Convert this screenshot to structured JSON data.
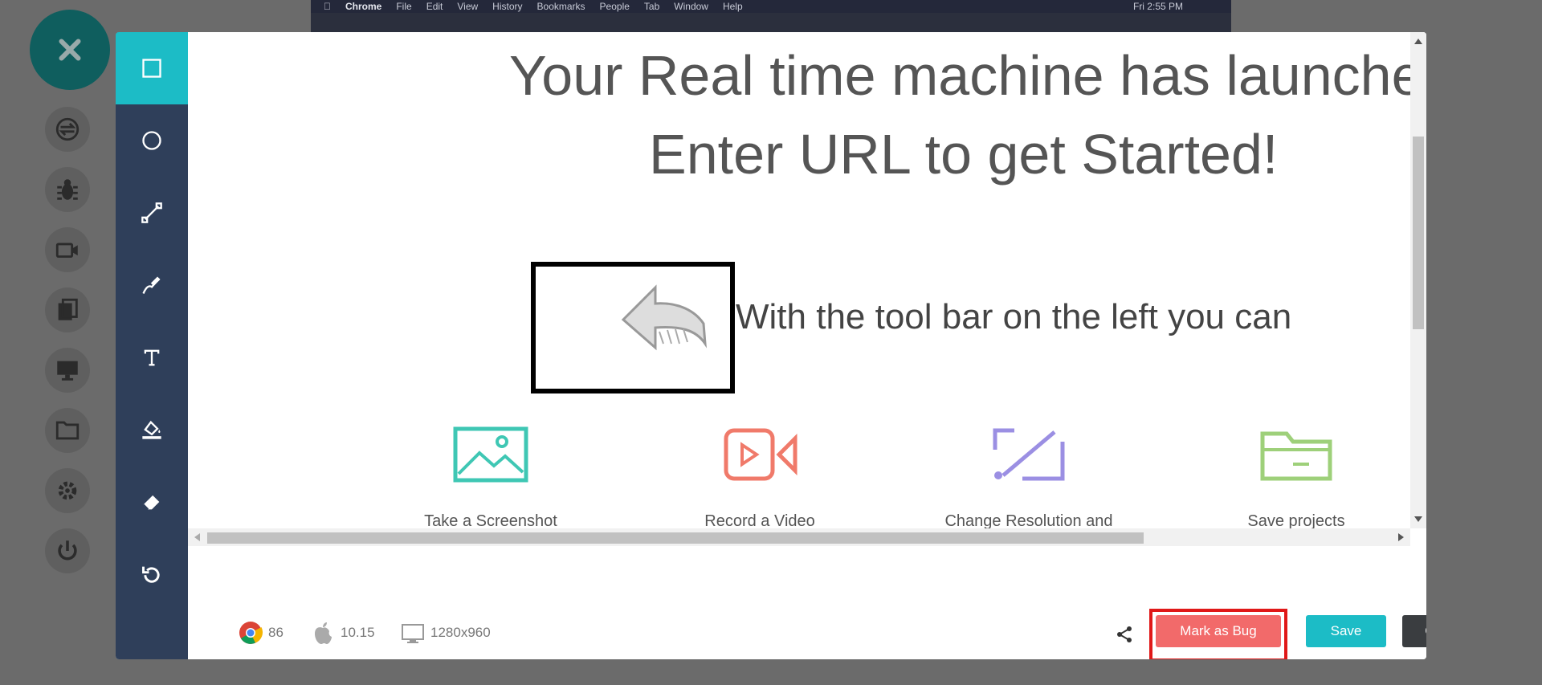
{
  "background_screen": {
    "app": "Chrome",
    "menus": [
      "File",
      "Edit",
      "View",
      "History",
      "Bookmarks",
      "People",
      "Tab",
      "Window",
      "Help"
    ],
    "clock": "Fri 2:55 PM"
  },
  "side_toolbar": {
    "close_icon": "close-icon",
    "items": [
      "switch-icon",
      "bug-icon",
      "video-icon",
      "copy-icon",
      "monitor-icon",
      "folder-icon",
      "gear-icon",
      "power-icon"
    ]
  },
  "tool_rail": {
    "tools": [
      "rectangle-icon",
      "circle-icon",
      "line-icon",
      "pen-icon",
      "text-icon",
      "fill-icon",
      "eraser-icon",
      "undo-icon"
    ],
    "active": "rectangle-icon"
  },
  "canvas": {
    "headline": "Your Real time machine has launched",
    "subheadline": "Enter URL to get Started!",
    "toolbar_text": "With the tool bar on the left you can",
    "features": [
      {
        "label": "Take a Screenshot",
        "icon": "image-icon",
        "color": "#3fc7b4"
      },
      {
        "label": "Record a Video",
        "icon": "video-icon",
        "color": "#f07a6a"
      },
      {
        "label": "Change Resolution and",
        "icon": "resolution-icon",
        "color": "#9b8fe3"
      },
      {
        "label": "Save projects",
        "icon": "folder-icon",
        "color": "#9ed07a"
      }
    ]
  },
  "footer": {
    "browser_version": "86",
    "os_version": "10.15",
    "resolution": "1280x960",
    "share_icon": "share-icon",
    "download_icon": "download-icon",
    "mark_bug_label": "Mark as Bug",
    "save_label": "Save",
    "close_label": "Close"
  },
  "colors": {
    "accent": "#1cbcc6",
    "rail": "#2f3f5a",
    "bug": "#f26a6a",
    "bug_highlight": "#e01818"
  }
}
